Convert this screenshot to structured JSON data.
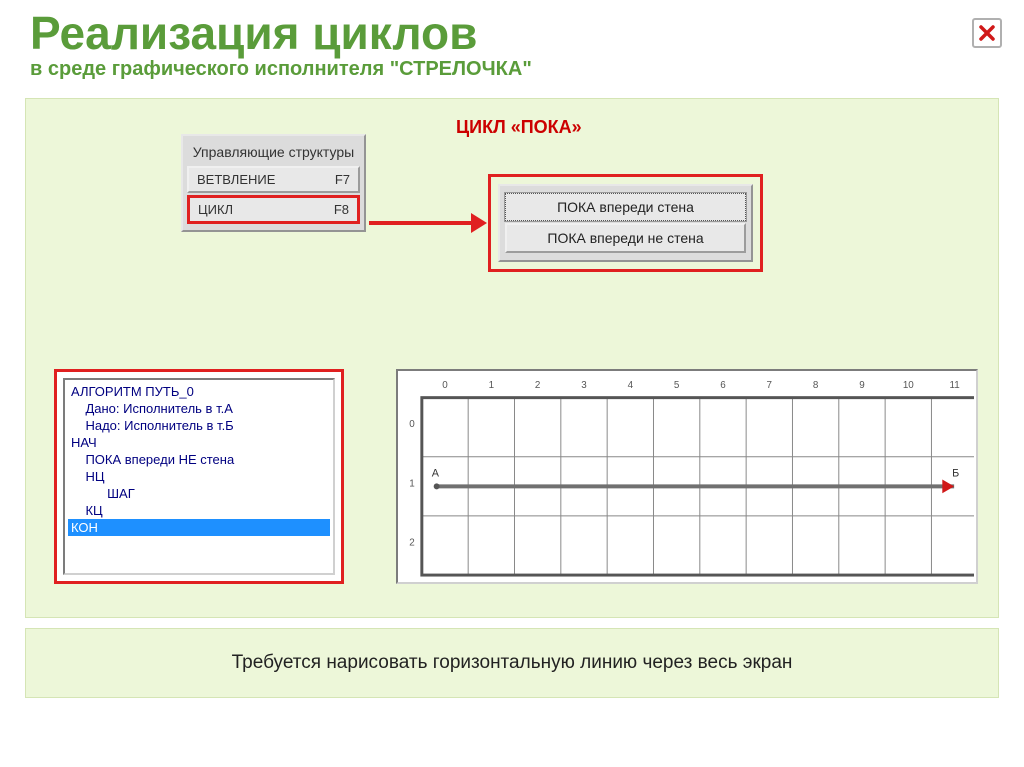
{
  "header": {
    "title": "Реализация   циклов",
    "subtitle": "в   среде   графического   исполнителя   \"СТРЕЛОЧКА\""
  },
  "section_title": "ЦИКЛ «ПОКА»",
  "control_structures": {
    "title": "Управляющие структуры",
    "buttons": [
      {
        "label": "ВЕТВЛЕНИЕ",
        "key": "F7"
      },
      {
        "label": "ЦИКЛ",
        "key": "F8"
      }
    ]
  },
  "while_panel": {
    "option1": "ПОКА впереди стена",
    "option2": "ПОКА впереди не стена"
  },
  "code": {
    "lines": [
      "АЛГОРИТМ ПУТЬ_0",
      "    Дано: Исполнитель в т.А",
      "    Надо: Исполнитель в т.Б",
      "НАЧ",
      "    ПОКА впереди НЕ стена",
      "    НЦ",
      "          ШАГ",
      "    КЦ",
      "КОН"
    ],
    "selected": 8
  },
  "grid": {
    "cols": [
      "0",
      "1",
      "2",
      "3",
      "4",
      "5",
      "6",
      "7",
      "8",
      "9",
      "10",
      "11"
    ],
    "rows": [
      "0",
      "1",
      "2"
    ],
    "pointA": "А",
    "pointB": "Б"
  },
  "bottom_text": "Требуется нарисовать горизонтальную линию через весь экран"
}
